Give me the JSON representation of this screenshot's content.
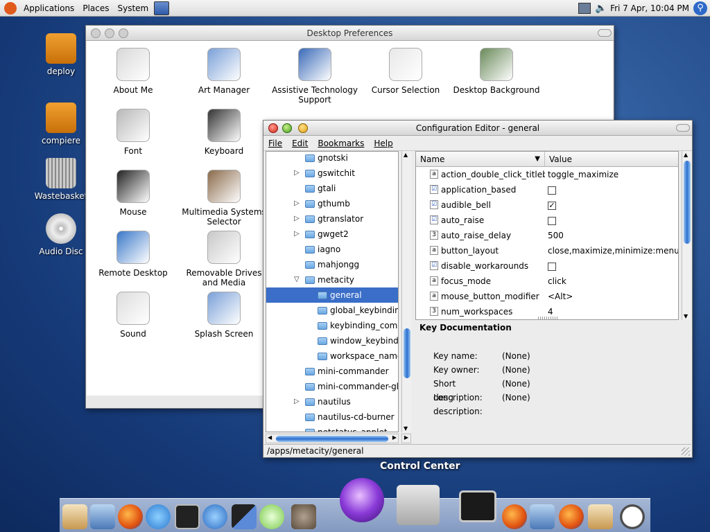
{
  "topbar": {
    "menus": [
      "Applications",
      "Places",
      "System"
    ],
    "datetime": "Fri 7 Apr, 10:04 PM"
  },
  "desktop_icons": [
    {
      "label": "deploy",
      "icon": "drive-icon",
      "color": "#f0a030"
    },
    {
      "label": "compiere",
      "icon": "drive-icon",
      "color": "#f0a030"
    },
    {
      "label": "Wastebasket",
      "icon": "trash-icon",
      "color": "#aaaaaa"
    },
    {
      "label": "Audio Disc",
      "icon": "cd-icon",
      "color": "#d8d8d8"
    }
  ],
  "desktop_prefs": {
    "title": "Desktop Preferences",
    "items": [
      {
        "label": "About Me"
      },
      {
        "label": "Art Manager"
      },
      {
        "label": "Assistive Technology Support"
      },
      {
        "label": "Cursor Selection"
      },
      {
        "label": "Desktop Background"
      },
      {
        "label": "Font"
      },
      {
        "label": "Keyboard"
      },
      {
        "label": "Mouse"
      },
      {
        "label": "Multimedia Systems Selector"
      },
      {
        "label": "Remote Desktop"
      },
      {
        "label": "Removable Drives and Media"
      },
      {
        "label": "Sound"
      },
      {
        "label": "Splash Screen"
      }
    ]
  },
  "config_editor": {
    "title": "Configuration Editor - general",
    "menu": [
      "File",
      "Edit",
      "Bookmarks",
      "Help"
    ],
    "tree": [
      {
        "label": "gnotski",
        "expander": false,
        "indent": 0,
        "selected": false
      },
      {
        "label": "gswitchit",
        "expander": true,
        "indent": 0,
        "selected": false
      },
      {
        "label": "gtali",
        "expander": false,
        "indent": 0,
        "selected": false
      },
      {
        "label": "gthumb",
        "expander": true,
        "indent": 0,
        "selected": false
      },
      {
        "label": "gtranslator",
        "expander": true,
        "indent": 0,
        "selected": false
      },
      {
        "label": "gwget2",
        "expander": true,
        "indent": 0,
        "selected": false
      },
      {
        "label": "iagno",
        "expander": false,
        "indent": 0,
        "selected": false
      },
      {
        "label": "mahjongg",
        "expander": false,
        "indent": 0,
        "selected": false
      },
      {
        "label": "metacity",
        "expander": "open",
        "indent": 0,
        "selected": false
      },
      {
        "label": "general",
        "expander": false,
        "indent": 1,
        "selected": true
      },
      {
        "label": "global_keybindings",
        "expander": false,
        "indent": 1,
        "selected": false
      },
      {
        "label": "keybinding_commands",
        "expander": false,
        "indent": 1,
        "selected": false
      },
      {
        "label": "window_keybindings",
        "expander": false,
        "indent": 1,
        "selected": false
      },
      {
        "label": "workspace_names",
        "expander": false,
        "indent": 1,
        "selected": false
      },
      {
        "label": "mini-commander",
        "expander": false,
        "indent": 0,
        "selected": false
      },
      {
        "label": "mini-commander-global",
        "expander": false,
        "indent": 0,
        "selected": false
      },
      {
        "label": "nautilus",
        "expander": true,
        "indent": 0,
        "selected": false
      },
      {
        "label": "nautilus-cd-burner",
        "expander": false,
        "indent": 0,
        "selected": false
      },
      {
        "label": "netstatus_applet",
        "expander": false,
        "indent": 0,
        "selected": false
      }
    ],
    "columns": {
      "name": "Name",
      "value": "Value"
    },
    "rows": [
      {
        "type": "a",
        "name": "action_double_click_titlebar",
        "value": "toggle_maximize"
      },
      {
        "type": "bool",
        "name": "application_based",
        "checked": false
      },
      {
        "type": "bool",
        "name": "audible_bell",
        "checked": true
      },
      {
        "type": "bool",
        "name": "auto_raise",
        "checked": false
      },
      {
        "type": "3",
        "name": "auto_raise_delay",
        "value": "500"
      },
      {
        "type": "a",
        "name": "button_layout",
        "value": "close,maximize,minimize:menu"
      },
      {
        "type": "bool",
        "name": "disable_workarounds",
        "checked": false
      },
      {
        "type": "a",
        "name": "focus_mode",
        "value": "click"
      },
      {
        "type": "a",
        "name": "mouse_button_modifier",
        "value": "<Alt>"
      },
      {
        "type": "3",
        "name": "num_workspaces",
        "value": "4"
      }
    ],
    "doc": {
      "heading": "Key Documentation",
      "fields": [
        {
          "label": "Key name:",
          "value": "(None)"
        },
        {
          "label": "Key owner:",
          "value": "(None)"
        },
        {
          "label": "Short description:",
          "value": "(None)"
        },
        {
          "label": "Long description:",
          "value": "(None)"
        }
      ]
    },
    "status_path": "/apps/metacity/general"
  },
  "dock": {
    "label": "Control Center"
  }
}
